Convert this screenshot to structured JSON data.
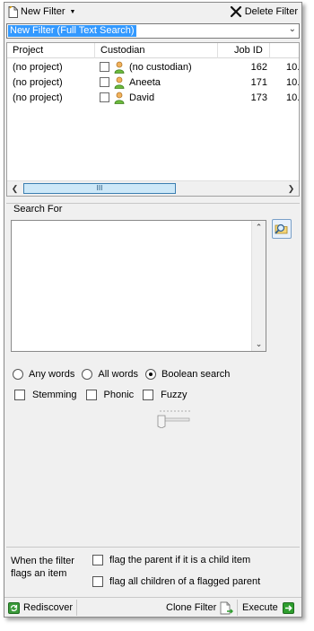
{
  "toolbar": {
    "new_filter_label": "New Filter",
    "delete_filter_label": "Delete Filter"
  },
  "filter_select": {
    "value": "New Filter (Full Text Search)"
  },
  "table": {
    "columns": [
      "Project",
      "Custodian",
      "Job ID"
    ],
    "rows": [
      {
        "project": "(no project)",
        "custodian": "(no custodian)",
        "job_id": "162",
        "extra": "10."
      },
      {
        "project": "(no project)",
        "custodian": "Aneeta",
        "job_id": "171",
        "extra": "10."
      },
      {
        "project": "(no project)",
        "custodian": "David",
        "job_id": "173",
        "extra": "10."
      }
    ],
    "scroll_thumb_label": "III"
  },
  "search": {
    "label": "Search For",
    "text": "",
    "match_options": [
      {
        "label": "Any words",
        "selected": false
      },
      {
        "label": "All words",
        "selected": false
      },
      {
        "label": "Boolean search",
        "selected": true
      }
    ],
    "modifiers": [
      {
        "label": "Stemming",
        "checked": false
      },
      {
        "label": "Phonic",
        "checked": false
      },
      {
        "label": "Fuzzy",
        "checked": false
      }
    ]
  },
  "flags": {
    "label": "When the filter flags an item",
    "options": [
      {
        "label": "flag the parent if it is a child item",
        "checked": false
      },
      {
        "label": "flag all children of a flagged parent",
        "checked": false
      }
    ]
  },
  "bottom_bar": {
    "rediscover_label": "Rediscover",
    "clone_filter_label": "Clone Filter",
    "execute_label": "Execute"
  },
  "colors": {
    "selection": "#3399ff",
    "panel": "#f0f0f0",
    "execute_green": "#2e9e2e"
  }
}
